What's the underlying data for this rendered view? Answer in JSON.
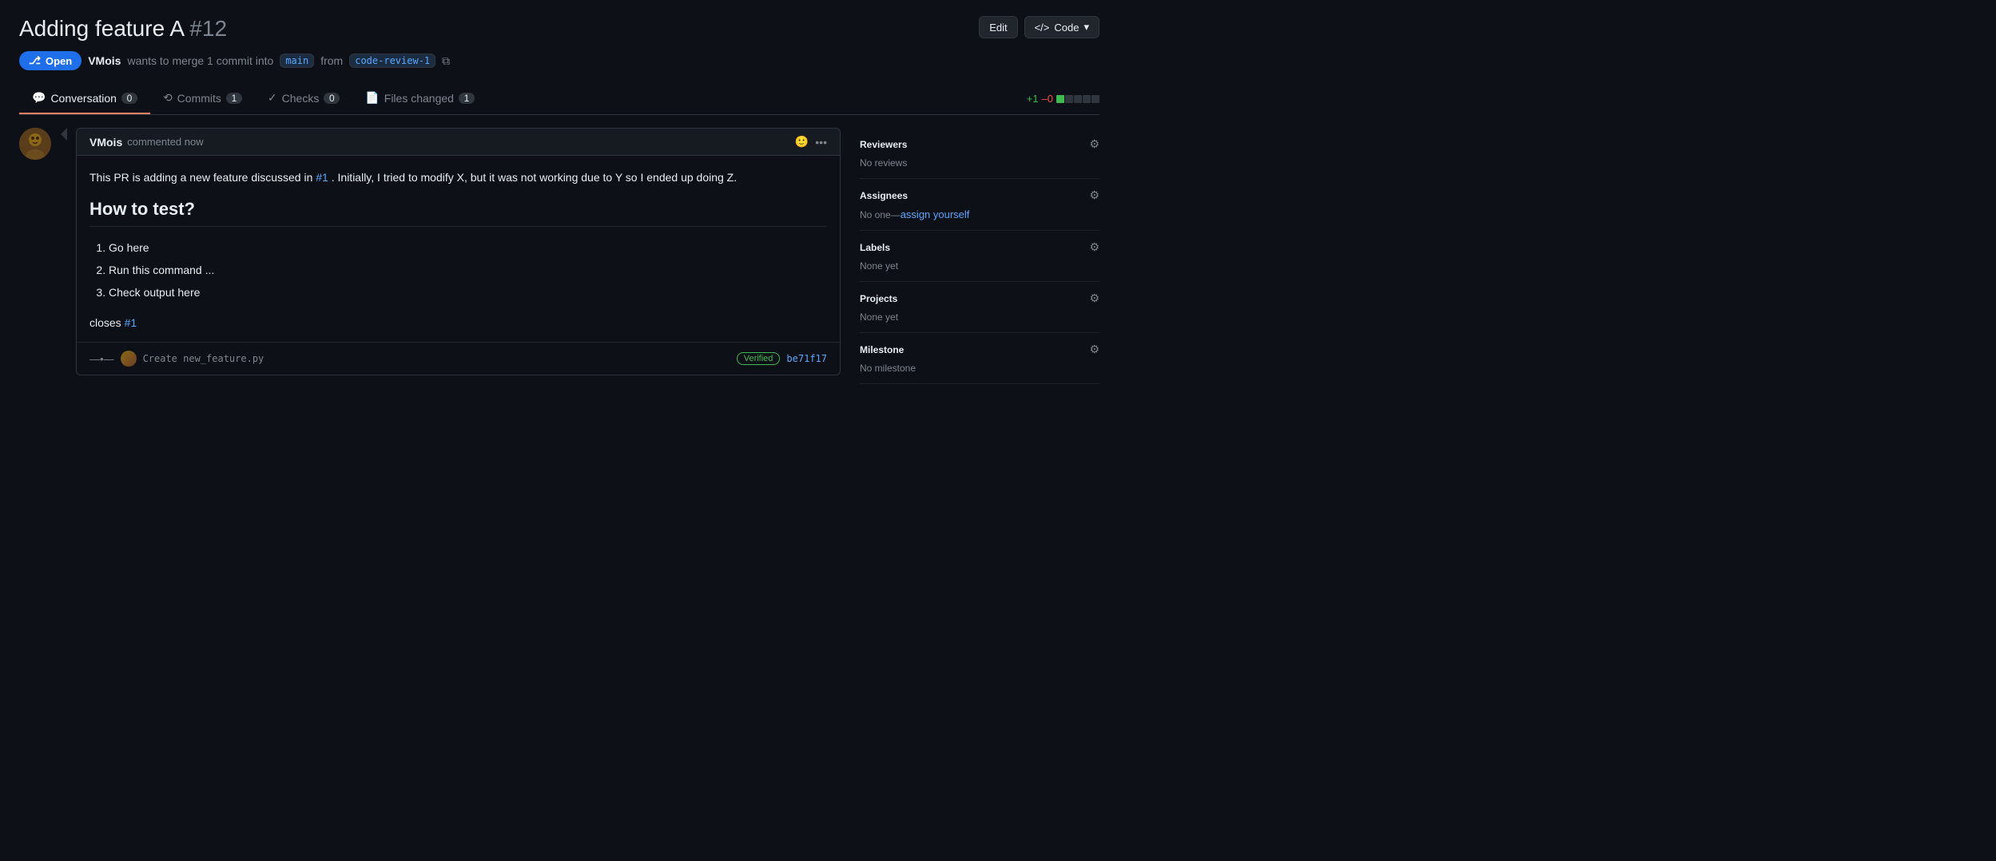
{
  "header": {
    "title": "Adding feature A",
    "pr_number": "#12",
    "edit_button": "Edit",
    "code_button": "Code"
  },
  "pr_meta": {
    "status": "Open",
    "author": "VMois",
    "action": "wants to merge 1 commit into",
    "base_branch": "main",
    "from_text": "from",
    "head_branch": "code-review-1"
  },
  "tabs": [
    {
      "label": "Conversation",
      "icon": "comment-icon",
      "count": "0",
      "active": true
    },
    {
      "label": "Commits",
      "icon": "commits-icon",
      "count": "1",
      "active": false
    },
    {
      "label": "Checks",
      "icon": "checks-icon",
      "count": "0",
      "active": false
    },
    {
      "label": "Files changed",
      "icon": "files-icon",
      "count": "1",
      "active": false
    }
  ],
  "diff_stat": {
    "additions": "+1",
    "deletions": "–0",
    "bars": [
      "green",
      "gray",
      "gray",
      "gray",
      "gray"
    ]
  },
  "comment": {
    "author": "VMois",
    "time": "commented now",
    "body_text": "This PR is adding a new feature discussed in #1 . Initially, I tried to modify X, but it was not working due to Y so I ended up doing Z.",
    "body_link_text": "#1",
    "how_to_test_heading": "How to test?",
    "steps": [
      "Go here",
      "Run this command ...",
      "Check output here"
    ],
    "closes_text": "closes",
    "closes_link": "#1"
  },
  "commit_row": {
    "icon": "commit-icon",
    "message": "Create new_feature.py",
    "verified_label": "Verified",
    "hash": "be71f17"
  },
  "sidebar": {
    "reviewers": {
      "title": "Reviewers",
      "value": "No reviews"
    },
    "assignees": {
      "title": "Assignees",
      "no_one": "No one",
      "assign_link": "assign yourself"
    },
    "labels": {
      "title": "Labels",
      "value": "None yet"
    },
    "projects": {
      "title": "Projects",
      "value": "None yet"
    },
    "milestone": {
      "title": "Milestone",
      "value": "No milestone"
    }
  }
}
